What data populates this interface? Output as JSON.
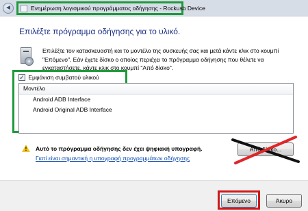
{
  "window": {
    "title": "Ενημέρωση λογισμικού προγράμματος οδήγησης - Rockusb Device",
    "back_glyph": "◄"
  },
  "main": {
    "heading": "Επιλέξτε πρόγραμμα οδήγησης για το υλικό.",
    "description": "Επιλέξτε τον κατασκευαστή και το μοντέλο της συσκευής σας και μετά κάντε κλικ στο κουμπί \"Επόμενο\". Εάν έχετε δίσκο ο οποίος περιέχει το πρόγραμμα οδήγησης που θέλετε να εγκαταστήσετε, κάντε κλικ στο κουμπί \"Από δίσκο\"."
  },
  "compatible": {
    "label": "Εμφάνιση συμβατού υλικού",
    "checked": true,
    "check_glyph": "✓"
  },
  "model_list": {
    "header": "Μοντέλο",
    "items": [
      "Android ADB Interface",
      "Android Original ADB Interface"
    ]
  },
  "warning": {
    "mark": "!",
    "text": "Αυτό το πρόγραμμα οδήγησης δεν έχει ψηφιακή υπογραφή.",
    "link": "Γιατί είναι σημαντική η υπογραφή προγραμμάτων οδήγησης"
  },
  "buttons": {
    "have_disk": "Από δίσκο...",
    "next": "Επόμενο",
    "cancel": "Άκυρο"
  },
  "colors": {
    "highlight_green": "#1e9a3a",
    "highlight_red": "#d01818",
    "heading_blue": "#1e3287",
    "link_blue": "#0645ad"
  }
}
